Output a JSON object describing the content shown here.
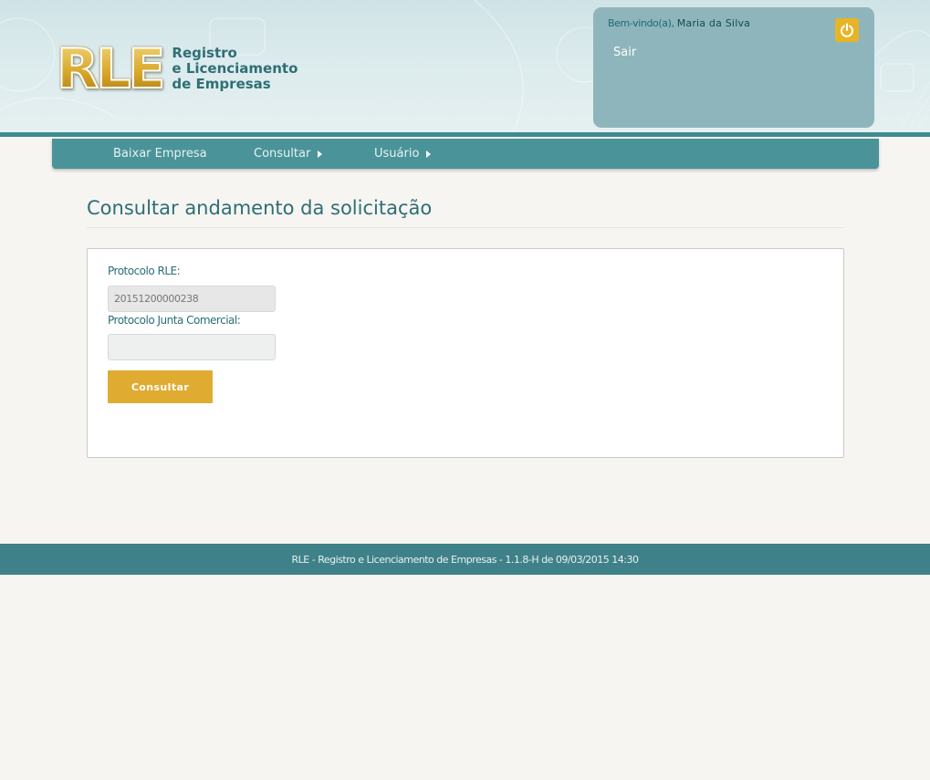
{
  "colors": {
    "header_stripe": "#3f8a8f",
    "navbar": "#4a9399",
    "user_box": "#8eb5bb",
    "title_text": "#2e6e75",
    "button": "#dfac31",
    "power_button": "#e8b427",
    "footer": "#3f8188",
    "page_background": "#f6f5f2"
  },
  "header": {
    "logo": {
      "mark": "RLE",
      "line1": "Registro",
      "line2": "e Licenciamento",
      "line3": "de Empresas"
    },
    "user": {
      "welcome_prefix": "Bem-vindo(a),",
      "user_name": "Maria da Silva",
      "logout_label": "Sair",
      "power_icon": "power-icon"
    }
  },
  "nav": {
    "items": [
      {
        "label": "Baixar Empresa",
        "has_submenu": false
      },
      {
        "label": "Consultar",
        "has_submenu": true
      },
      {
        "label": "Usuário",
        "has_submenu": true
      }
    ]
  },
  "main": {
    "title": "Consultar andamento da solicitação",
    "form": {
      "protocolo_rle_label": "Protocolo RLE:",
      "protocolo_rle_value": "20151200000238",
      "protocolo_junta_label": "Protocolo Junta Comercial:",
      "protocolo_junta_value": "",
      "submit_label": "Consultar"
    }
  },
  "footer": {
    "text": "RLE - Registro e Licenciamento de Empresas - 1.1.8-H de 09/03/2015 14:30"
  }
}
